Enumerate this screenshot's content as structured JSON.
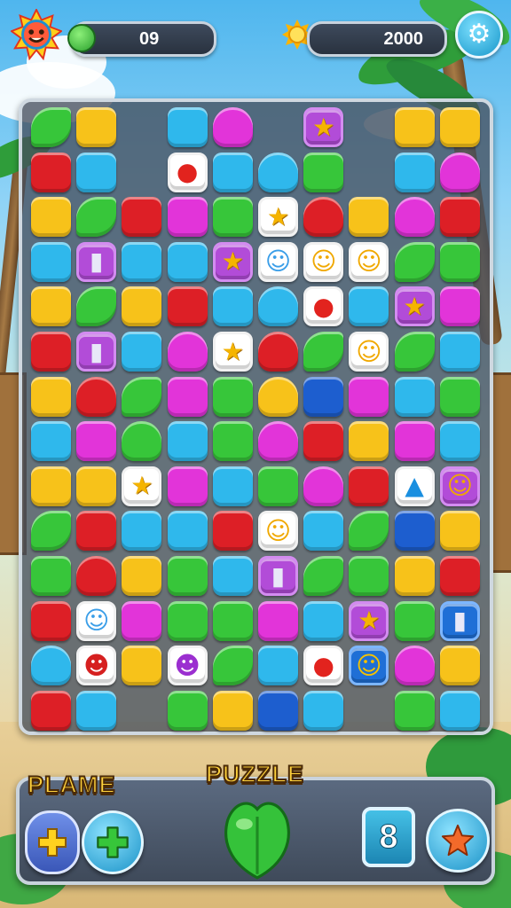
{
  "hud": {
    "moves_value": "09",
    "coins_value": "2000",
    "avatar_icon": "sun-face-icon",
    "moves_icon": "green-heart-icon",
    "coins_icon": "sun-coin-icon",
    "settings_icon": "gear-icon"
  },
  "bottom_bar": {
    "left_title": "PLAME",
    "center_title": "PUZZLE",
    "counter_value": "8",
    "buttons": [
      "plus-button",
      "green-plus-button",
      "star-button"
    ]
  },
  "colors": {
    "y": "#f7c21a",
    "b": "#2fb8ec",
    "g": "#37c63a",
    "r": "#dd1f26",
    "m": "#e234d9",
    "d": "#1d5ecf",
    "p": "#b24cd8",
    "lp": "#d14ae6"
  },
  "board": {
    "rows": [
      [
        [
          "g",
          "leaf"
        ],
        [
          "y"
        ],
        null,
        [
          "b"
        ],
        [
          "m",
          "heart"
        ],
        null,
        [
          "sp:star",
          "purplebox"
        ],
        null,
        [
          "y"
        ],
        [
          "y"
        ]
      ],
      [
        [
          "r"
        ],
        [
          "b"
        ],
        null,
        [
          "sp:apple"
        ],
        [
          "b"
        ],
        [
          "b",
          "heart"
        ],
        [
          "g"
        ],
        null,
        [
          "b"
        ],
        [
          "m",
          "heart"
        ]
      ],
      [
        [
          "y"
        ],
        [
          "g",
          "leaf"
        ],
        [
          "r"
        ],
        [
          "m"
        ],
        [
          "g"
        ],
        [
          "sp:star"
        ],
        [
          "r",
          "heart"
        ],
        [
          "y"
        ],
        [
          "m",
          "heart"
        ],
        [
          "r"
        ]
      ],
      [
        [
          "b"
        ],
        [
          "sp:bottle",
          "purplebox"
        ],
        [
          "b"
        ],
        [
          "b"
        ],
        [
          "sp:star",
          "purplebox"
        ],
        [
          "sp:cat-blue"
        ],
        [
          "sp:cat"
        ],
        [
          "sp:cat"
        ],
        [
          "g",
          "leaf"
        ],
        [
          "g"
        ]
      ],
      [
        [
          "y"
        ],
        [
          "g",
          "leaf"
        ],
        [
          "y"
        ],
        [
          "r"
        ],
        [
          "b"
        ],
        [
          "b",
          "heart"
        ],
        [
          "sp:apple"
        ],
        [
          "b"
        ],
        [
          "sp:star",
          "purplebox"
        ],
        [
          "m"
        ]
      ],
      [
        [
          "r"
        ],
        [
          "sp:bottle",
          "purplebox"
        ],
        [
          "b"
        ],
        [
          "m",
          "heart"
        ],
        [
          "sp:star"
        ],
        [
          "r",
          "heart"
        ],
        [
          "g",
          "leaf"
        ],
        [
          "sp:cat"
        ],
        [
          "g",
          "leaf"
        ],
        [
          "b"
        ]
      ],
      [
        [
          "y"
        ],
        [
          "r",
          "heart"
        ],
        [
          "g",
          "leaf"
        ],
        [
          "m"
        ],
        [
          "g"
        ],
        [
          "y",
          "heart"
        ],
        [
          "d"
        ],
        [
          "m"
        ],
        [
          "b"
        ],
        [
          "g"
        ]
      ],
      [
        [
          "b"
        ],
        [
          "m"
        ],
        [
          "g",
          "heart"
        ],
        [
          "b"
        ],
        [
          "g"
        ],
        [
          "m",
          "heart"
        ],
        [
          "r"
        ],
        [
          "y"
        ],
        [
          "m"
        ],
        [
          "b"
        ]
      ],
      [
        [
          "y"
        ],
        [
          "y"
        ],
        [
          "sp:star"
        ],
        [
          "m"
        ],
        [
          "b"
        ],
        [
          "g"
        ],
        [
          "m",
          "heart"
        ],
        [
          "r"
        ],
        [
          "sp:bottle-blue"
        ],
        [
          "sp:cat",
          "purplebox"
        ]
      ],
      [
        [
          "g",
          "leaf"
        ],
        [
          "r"
        ],
        [
          "b"
        ],
        [
          "b"
        ],
        [
          "r"
        ],
        [
          "sp:cat"
        ],
        [
          "b"
        ],
        [
          "g",
          "leaf"
        ],
        [
          "d"
        ],
        [
          "y"
        ]
      ],
      [
        [
          "g"
        ],
        [
          "r",
          "heart"
        ],
        [
          "y"
        ],
        [
          "g"
        ],
        [
          "b"
        ],
        [
          "sp:bottle",
          "purplebox"
        ],
        [
          "g",
          "leaf"
        ],
        [
          "g"
        ],
        [
          "y"
        ],
        [
          "r"
        ]
      ],
      [
        [
          "r"
        ],
        [
          "sp:cat-blue"
        ],
        [
          "m"
        ],
        [
          "g"
        ],
        [
          "g"
        ],
        [
          "m"
        ],
        [
          "b"
        ],
        [
          "sp:star",
          "purplebox"
        ],
        [
          "g"
        ],
        [
          "sp:bottle",
          "bluebox"
        ]
      ],
      [
        [
          "b",
          "heart"
        ],
        [
          "sp:devil"
        ],
        [
          "y"
        ],
        [
          "sp:purple-face"
        ],
        [
          "g",
          "leaf"
        ],
        [
          "b"
        ],
        [
          "sp:apple"
        ],
        [
          "sp:cat-face",
          "bluebox"
        ],
        [
          "m",
          "heart"
        ],
        [
          "y"
        ]
      ],
      [
        [
          "r"
        ],
        [
          "b"
        ],
        null,
        [
          "g"
        ],
        [
          "y"
        ],
        [
          "d"
        ],
        [
          "b"
        ],
        null,
        [
          "g"
        ],
        [
          "b"
        ]
      ]
    ]
  }
}
